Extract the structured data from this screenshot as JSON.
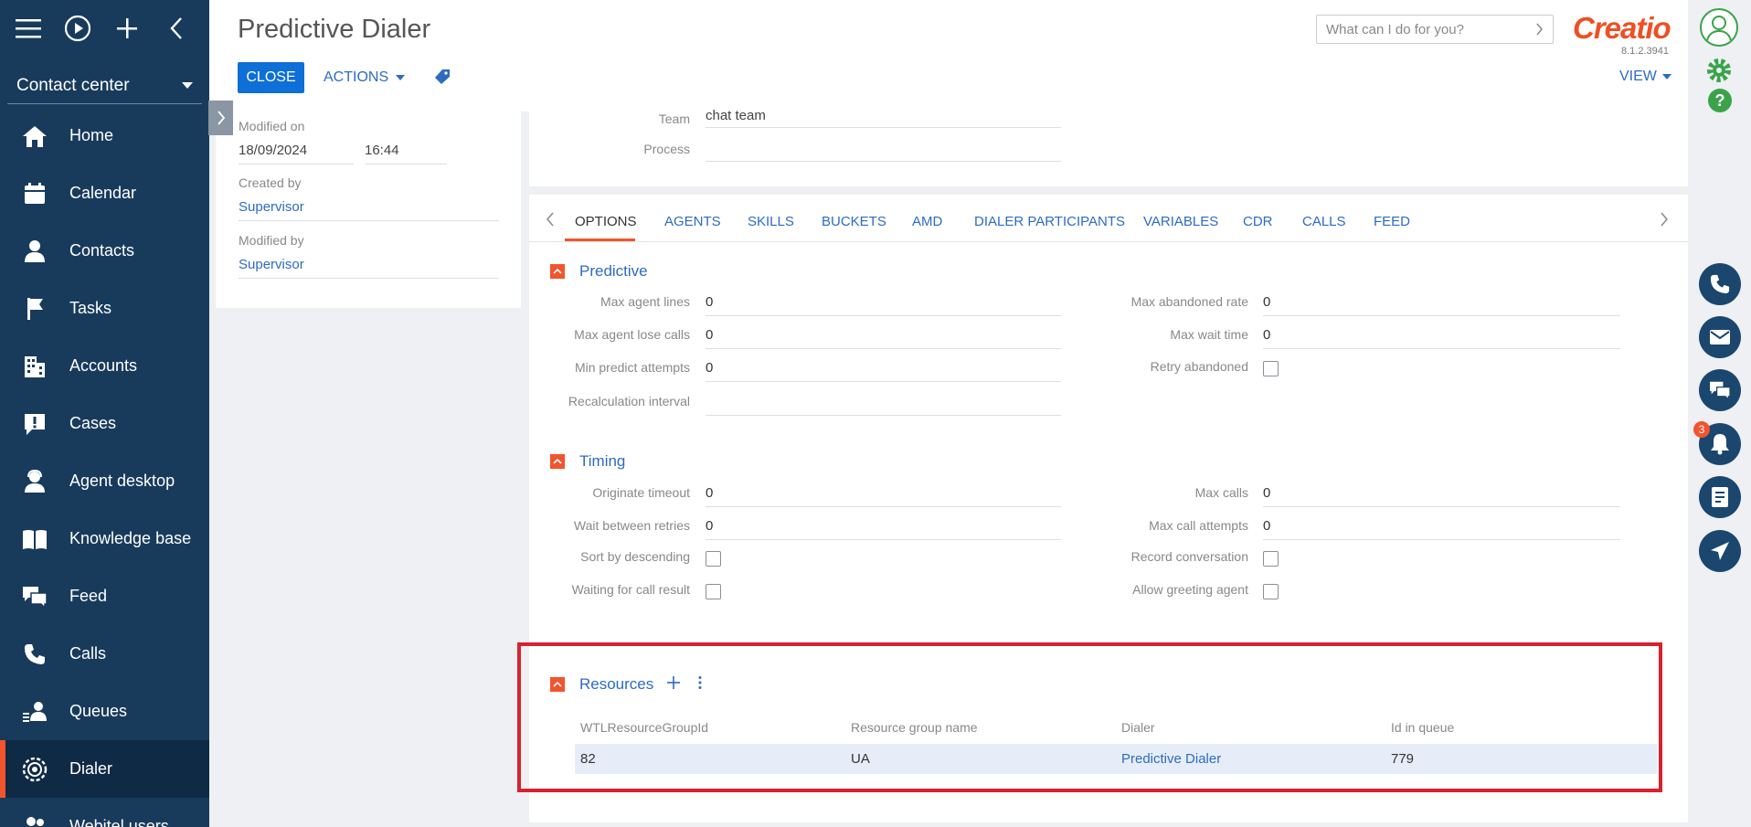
{
  "sidebar": {
    "workspace": "Contact center",
    "items": [
      {
        "label": "Home",
        "icon": "home-icon"
      },
      {
        "label": "Calendar",
        "icon": "calendar-icon"
      },
      {
        "label": "Contacts",
        "icon": "person-icon"
      },
      {
        "label": "Tasks",
        "icon": "flag-icon"
      },
      {
        "label": "Accounts",
        "icon": "building-icon"
      },
      {
        "label": "Cases",
        "icon": "alert-bubble-icon"
      },
      {
        "label": "Agent desktop",
        "icon": "headset-agent-icon"
      },
      {
        "label": "Knowledge base",
        "icon": "book-icon"
      },
      {
        "label": "Feed",
        "icon": "chat-bubbles-icon"
      },
      {
        "label": "Calls",
        "icon": "phone-icon"
      },
      {
        "label": "Queues",
        "icon": "queue-people-icon"
      },
      {
        "label": "Dialer",
        "icon": "dialer-gear-icon"
      },
      {
        "label": "Webitel users",
        "icon": "users-icon"
      }
    ],
    "active_item": "Dialer"
  },
  "header": {
    "title": "Predictive Dialer",
    "close_label": "CLOSE",
    "actions_label": "ACTIONS",
    "search_placeholder": "What can I do for you?",
    "logo_text": "Creatio",
    "version": "8.1.2.3941",
    "view_label": "VIEW"
  },
  "info_card": {
    "modified_on_label": "Modified on",
    "modified_on_date": "18/09/2024",
    "modified_on_time": "16:44",
    "created_by_label": "Created by",
    "created_by_value": "Supervisor",
    "modified_by_label": "Modified by",
    "modified_by_value": "Supervisor"
  },
  "top_card": {
    "team_label": "Team",
    "team_value": "chat team",
    "process_label": "Process",
    "process_value": ""
  },
  "tabs": [
    "OPTIONS",
    "AGENTS",
    "SKILLS",
    "BUCKETS",
    "AMD",
    "DIALER PARTICIPANTS",
    "VARIABLES",
    "CDR",
    "CALLS",
    "FEED"
  ],
  "active_tab": "OPTIONS",
  "predictive": {
    "title": "Predictive",
    "max_agent_lines_label": "Max agent lines",
    "max_agent_lines": "0",
    "max_agent_lose_calls_label": "Max agent lose calls",
    "max_agent_lose_calls": "0",
    "min_predict_attempts_label": "Min predict attempts",
    "min_predict_attempts": "0",
    "recalculation_interval_label": "Recalculation interval",
    "recalculation_interval": "",
    "max_abandoned_rate_label": "Max abandoned rate",
    "max_abandoned_rate": "0",
    "max_wait_time_label": "Max wait time",
    "max_wait_time": "0",
    "retry_abandoned_label": "Retry abandoned",
    "retry_abandoned": false
  },
  "timing": {
    "title": "Timing",
    "originate_timeout_label": "Originate timeout",
    "originate_timeout": "0",
    "wait_between_retries_label": "Wait between retries",
    "wait_between_retries": "0",
    "sort_by_descending_label": "Sort by descending",
    "sort_by_descending": false,
    "waiting_for_call_result_label": "Waiting for call result",
    "waiting_for_call_result": false,
    "max_calls_label": "Max calls",
    "max_calls": "0",
    "max_call_attempts_label": "Max call attempts",
    "max_call_attempts": "0",
    "record_conversation_label": "Record conversation",
    "record_conversation": false,
    "allow_greeting_agent_label": "Allow greeting agent",
    "allow_greeting_agent": false
  },
  "resources": {
    "title": "Resources",
    "columns": [
      "WTLResourceGroupId",
      "Resource group name",
      "Dialer",
      "Id in queue"
    ],
    "rows": [
      {
        "group_id": "82",
        "group_name": "UA",
        "dialer": "Predictive Dialer",
        "id_in_queue": "779"
      }
    ]
  },
  "rail": {
    "notification_count": "3"
  },
  "colors": {
    "sidebar_bg": "#183b5c",
    "accent": "#f2542d",
    "primary_button": "#0d6fd7",
    "link": "#2d6bc2",
    "highlight_border": "#d8212f"
  }
}
